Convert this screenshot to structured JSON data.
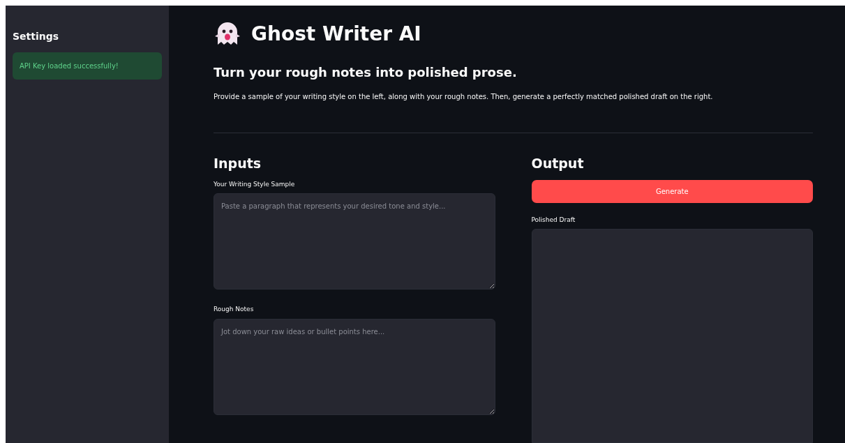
{
  "sidebar": {
    "title": "Settings",
    "alert": {
      "text": "API Key loaded successfully!"
    }
  },
  "header": {
    "title": "Ghost Writer AI",
    "subtitle": "Turn your rough notes into polished prose.",
    "description": "Provide a sample of your writing style on the left, along with your rough notes. Then, generate a perfectly matched polished draft on the right."
  },
  "inputs": {
    "heading": "Inputs",
    "fields": [
      {
        "label": "Your Writing Style Sample",
        "placeholder": "Paste a paragraph that represents your desired tone and style..."
      },
      {
        "label": "Rough Notes",
        "placeholder": "Jot down your raw ideas or bullet points here..."
      }
    ]
  },
  "output": {
    "heading": "Output",
    "button": "Generate",
    "field": {
      "label": "Polished Draft"
    }
  }
}
